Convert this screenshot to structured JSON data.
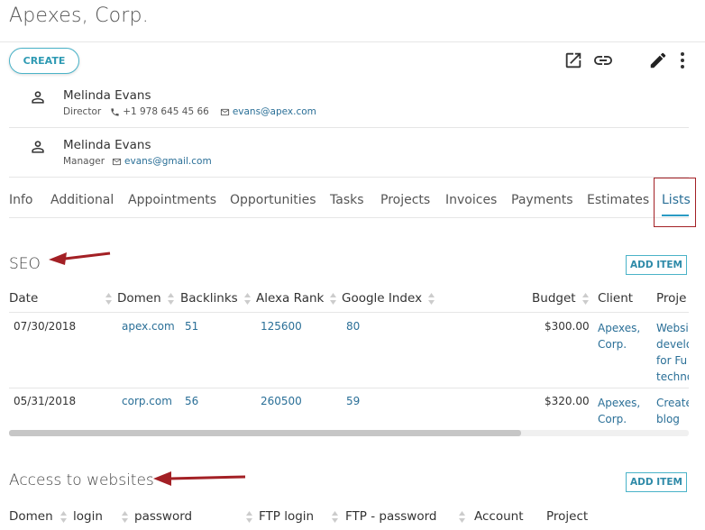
{
  "header": {
    "title": "Apexes, Corp.",
    "create_label": "CREATE"
  },
  "contacts": [
    {
      "name": "Melinda Evans",
      "role": "Director",
      "phone": "+1 978 645 45 66",
      "email": "evans@apex.com"
    },
    {
      "name": "Melinda Evans",
      "role": "Manager",
      "email": "evans@gmail.com"
    }
  ],
  "tabs": [
    "Info",
    "Additional",
    "Appointments",
    "Opportunities",
    "Tasks",
    "Projects",
    "Invoices",
    "Payments",
    "Estimates",
    "Lists"
  ],
  "active_tab": "Lists",
  "seo": {
    "title": "SEO",
    "add_label": "ADD ITEM",
    "columns": [
      "Date",
      "Domen",
      "Backlinks",
      "Alexa Rank",
      "Google Index",
      "Budget",
      "Client",
      "Proje"
    ],
    "rows": [
      {
        "date": "07/30/2018",
        "domen": "apex.com",
        "backlinks": "51",
        "alexa": "125600",
        "google": "80",
        "budget": "$300.00",
        "client": [
          "Apexes,",
          "Corp."
        ],
        "project": [
          "Websi",
          "develo",
          "for Fu",
          "techno"
        ]
      },
      {
        "date": "05/31/2018",
        "domen": "corp.com",
        "backlinks": "56",
        "alexa": "260500",
        "google": "59",
        "budget": "$320.00",
        "client": [
          "Apexes,",
          "Corp."
        ],
        "project": [
          "Create",
          "blog"
        ]
      }
    ]
  },
  "access": {
    "title": "Access to websites",
    "add_label": "ADD ITEM",
    "columns": [
      "Domen",
      "login",
      "password",
      "FTP login",
      "FTP - password",
      "Account",
      "Project"
    ]
  },
  "colors": {
    "accent": "#2a6f97",
    "annotation": "#a32025",
    "button_border": "#4ab3c8"
  }
}
